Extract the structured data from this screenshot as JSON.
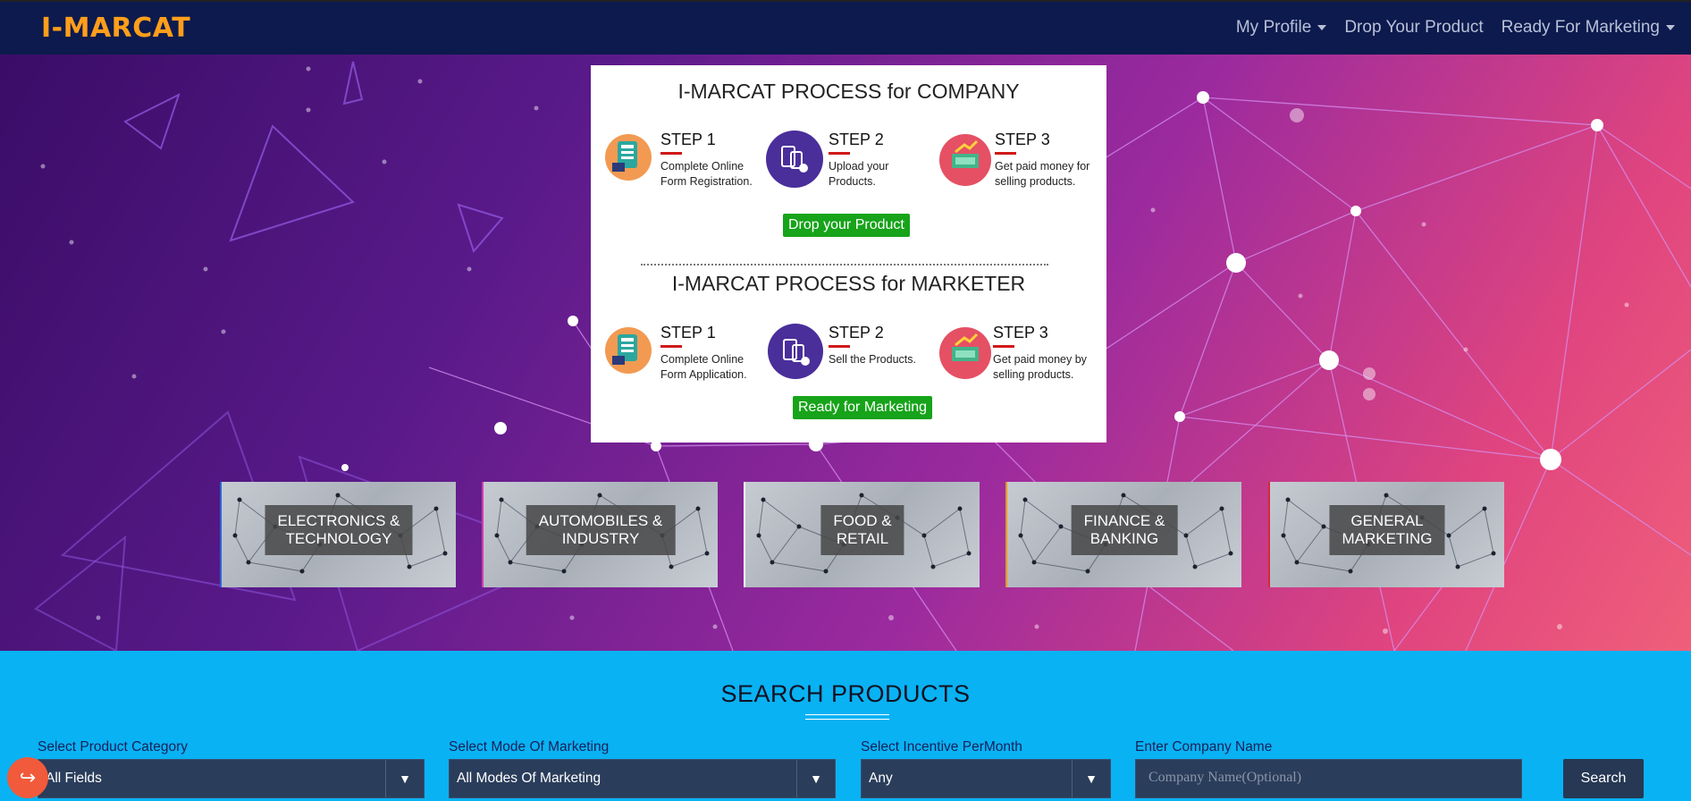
{
  "brand": {
    "logo": "I-MARCAT"
  },
  "nav": {
    "my_profile": "My Profile",
    "drop_product": "Drop Your Product",
    "ready_marketing": "Ready For Marketing"
  },
  "process": {
    "company": {
      "title": "I-MARCAT PROCESS for COMPANY",
      "steps": [
        {
          "title": "STEP 1",
          "text": "Complete Online Form Registration.",
          "icon": "registration-form-icon"
        },
        {
          "title": "STEP 2",
          "text": "Upload your Products.",
          "icon": "upload-mobile-icon"
        },
        {
          "title": "STEP 3",
          "text": "Get paid money for selling products.",
          "icon": "money-icon"
        }
      ],
      "button": "Drop your Product"
    },
    "marketer": {
      "title": "I-MARCAT PROCESS for MARKETER",
      "steps": [
        {
          "title": "STEP 1",
          "text": "Complete Online Form Application.",
          "icon": "registration-form-icon"
        },
        {
          "title": "STEP 2",
          "text": "Sell the Products.",
          "icon": "sell-mobile-icon"
        },
        {
          "title": "STEP 3",
          "text": "Get paid money by selling products.",
          "icon": "money-icon"
        }
      ],
      "button": "Ready for Marketing"
    }
  },
  "categories": [
    {
      "label": "ELECTRONICS &\nTECHNOLOGY",
      "accent": "#2a62d6"
    },
    {
      "label": "AUTOMOBILES &\nINDUSTRY",
      "accent": "#d13ab0"
    },
    {
      "label": "FOOD &\nRETAIL",
      "accent": "#ffffff"
    },
    {
      "label": "FINANCE &\nBANKING",
      "accent": "#e89a1c"
    },
    {
      "label": "GENERAL\nMARKETING",
      "accent": "#d42a3a"
    }
  ],
  "search": {
    "title": "SEARCH PRODUCTS",
    "category": {
      "label": "Select Product Category",
      "value": "All Fields"
    },
    "mode": {
      "label": "Select Mode Of Marketing",
      "value": "All Modes Of Marketing"
    },
    "incentive": {
      "label": "Select Incentive PerMonth",
      "value": "Any"
    },
    "company": {
      "label": "Enter Company Name",
      "placeholder": "Company Name(Optional)"
    },
    "button": "Search"
  },
  "colors": {
    "logo": "#ff9e1b",
    "navbar": "#0c1a4e",
    "search_bg": "#09b2f3",
    "step_button": "#17a31a",
    "share": "#f15a3a"
  },
  "icons": {
    "dropdown_arrow": "▼",
    "share": "↪"
  }
}
